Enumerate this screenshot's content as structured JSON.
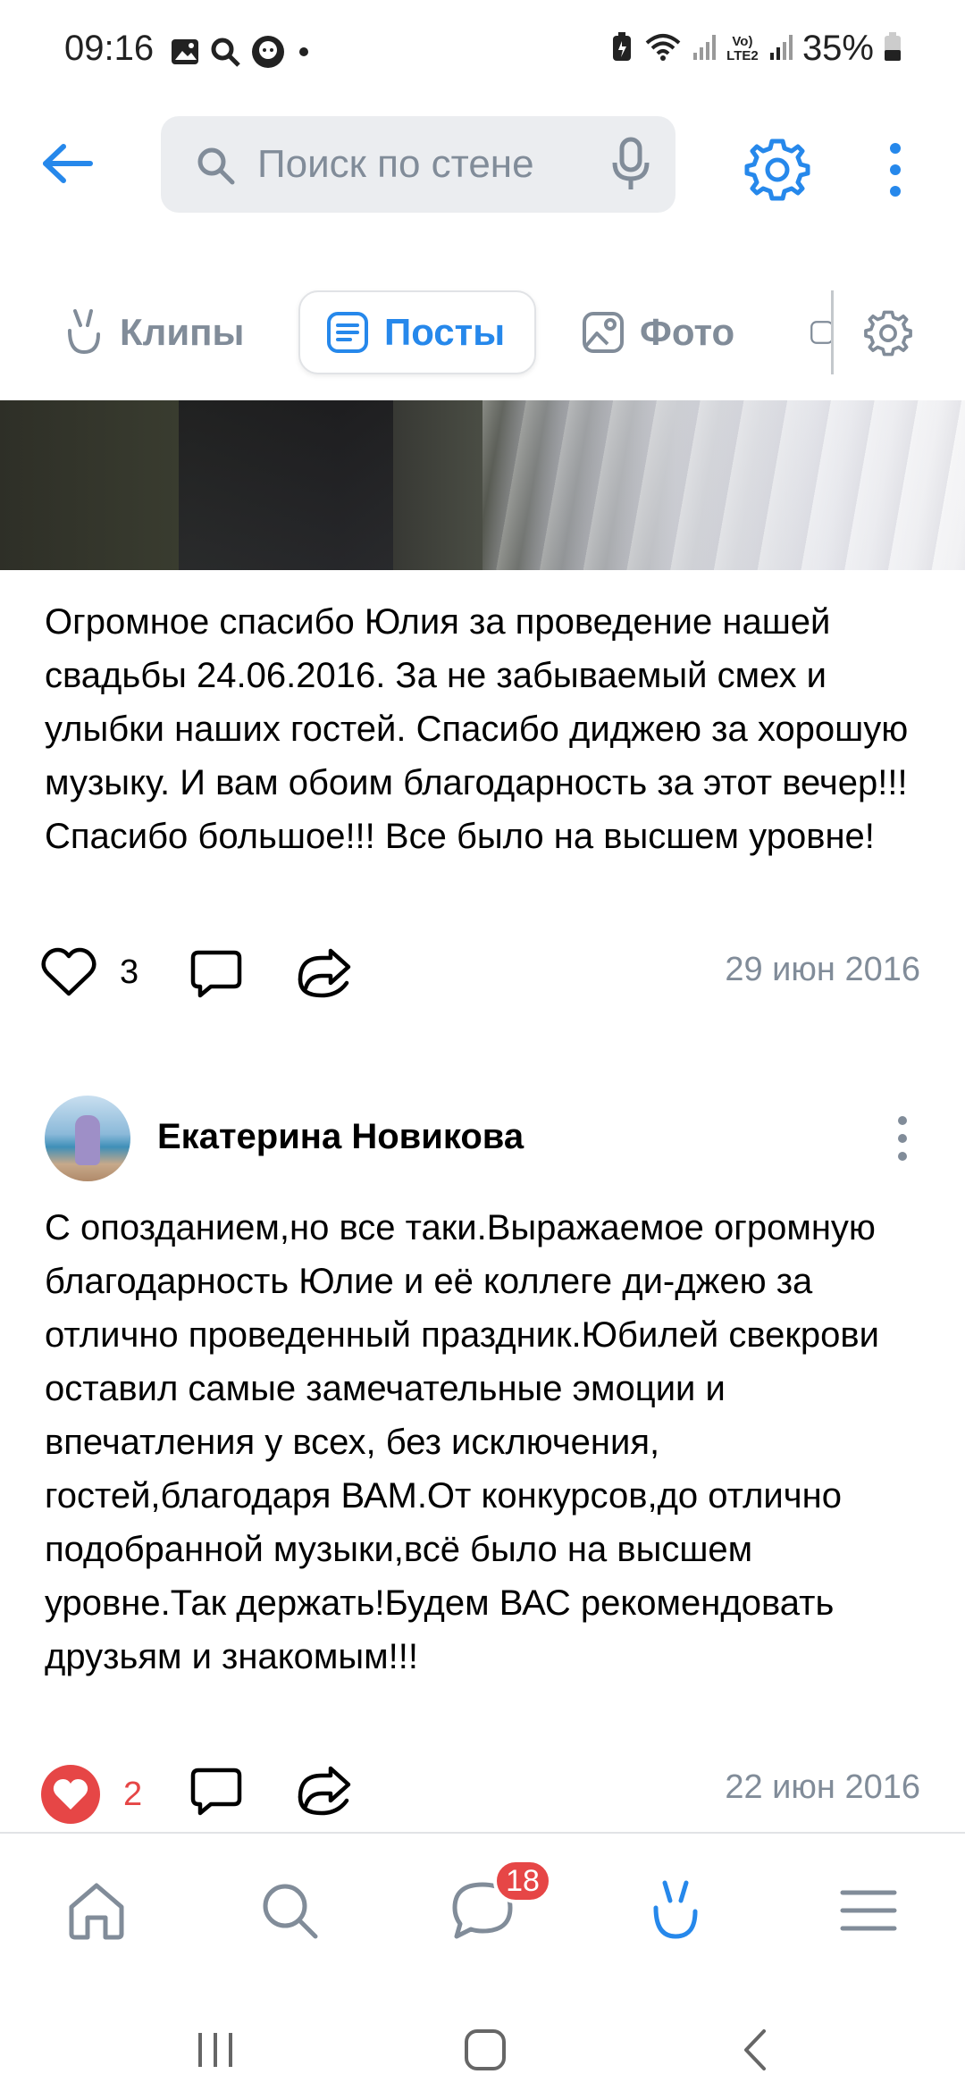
{
  "status_bar": {
    "time": "09:16",
    "battery_percent": "35%",
    "network_label": "Vo) LTE2"
  },
  "top_bar": {
    "search_placeholder": "Поиск по стене"
  },
  "tabs": [
    {
      "label": "Клипы",
      "icon": "clips-icon",
      "active": false
    },
    {
      "label": "Посты",
      "icon": "posts-icon",
      "active": true
    },
    {
      "label": "Фото",
      "icon": "photo-icon",
      "active": false
    }
  ],
  "posts": [
    {
      "text": "Огромное спасибо Юлия за проведение нашей свадьбы 24.06.2016. За не забываемый смех и улыбки наших гостей. Спасибо диджею за хорошую музыку. И вам обоим благодарность за этот вечер!!! Спасибо большое!!! Все было на высшем уровне!",
      "likes": "3",
      "liked": false,
      "date": "29 июн 2016"
    },
    {
      "author": "Екатерина Новикова",
      "text": "С опозданием,но все таки.Выражаемое огромную благодарность Юлие и её коллеге ди-джею за отлично проведенный праздник.Юбилей свекрови оставил самые замечательные эмоции и впечатления у всех, без исключения, гостей,благодаря ВАМ.От конкурсов,до отлично подобранной музыки,всё было на высшем уровне.Так держать!Будем ВАС рекомендовать друзьям и знакомым!!!",
      "likes": "2",
      "liked": true,
      "date": "22 июн 2016"
    }
  ],
  "bottom_nav": {
    "items": [
      "home-icon",
      "search-icon",
      "messages-icon",
      "clips-icon",
      "menu-icon"
    ],
    "messages_badge": "18"
  },
  "colors": {
    "accent": "#2688eb",
    "secondary_text": "#818c99",
    "like_red": "#e64646"
  }
}
